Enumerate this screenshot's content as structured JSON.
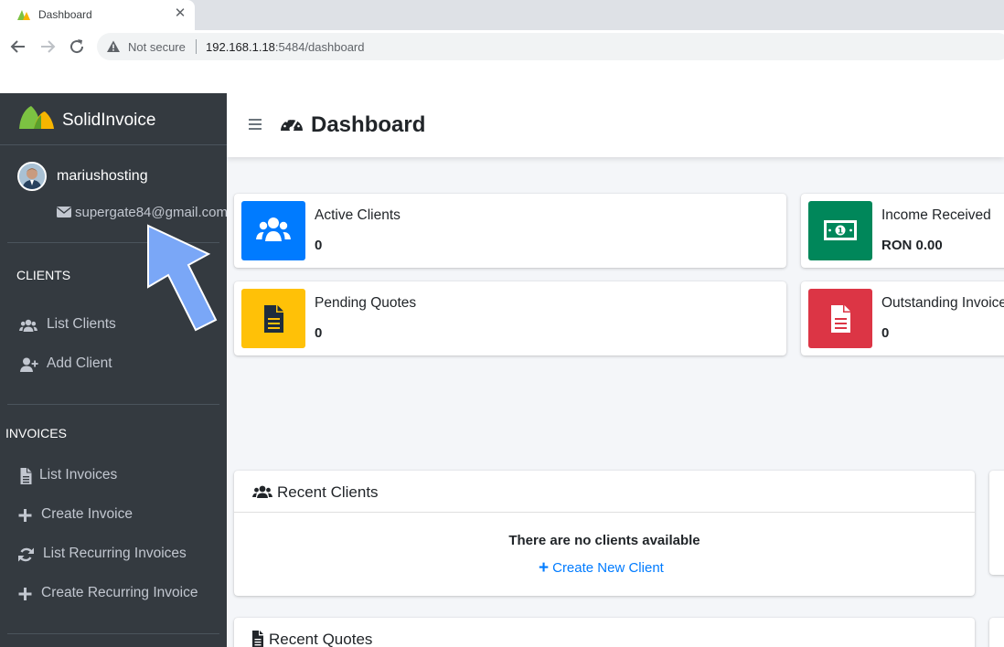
{
  "browser": {
    "tab_title": "Dashboard",
    "tab_close": "✕",
    "not_secure": "Not secure",
    "url_host": "192.168.1.18",
    "url_path": ":5484/dashboard"
  },
  "sidebar": {
    "brand": "SolidInvoice",
    "user": {
      "name": "mariushosting",
      "email": "supergate84@gmail.com"
    },
    "sections": [
      {
        "header": "CLIENTS",
        "items": [
          {
            "label": "List Clients",
            "icon": "users-icon"
          },
          {
            "label": "Add Client",
            "icon": "user-plus-icon"
          }
        ]
      },
      {
        "header": "INVOICES",
        "items": [
          {
            "label": "List Invoices",
            "icon": "file-icon"
          },
          {
            "label": "Create Invoice",
            "icon": "plus-icon"
          },
          {
            "label": "List Recurring Invoices",
            "icon": "sync-icon"
          },
          {
            "label": "Create Recurring Invoice",
            "icon": "plus-icon"
          }
        ]
      }
    ]
  },
  "main": {
    "title": "Dashboard",
    "info_boxes": [
      {
        "label": "Active Clients",
        "value": "0",
        "color": "#007bff",
        "icon": "users-icon"
      },
      {
        "label": "Income Received",
        "value": "RON 0.00",
        "color": "#00875a",
        "icon": "money-bill-icon"
      },
      {
        "label": "Pending Quotes",
        "value": "0",
        "color": "#ffc107",
        "icon": "file-alt-icon"
      },
      {
        "label": "Outstanding Invoices",
        "value": "0",
        "color": "#dc3545",
        "icon": "file-invoice-icon"
      }
    ],
    "recent_clients": {
      "title": "Recent Clients",
      "empty_text": "There are no clients available",
      "create_link": "Create New Client"
    },
    "recent_quotes": {
      "title": "Recent Quotes"
    }
  },
  "colors": {
    "sidebar_bg": "#343a40",
    "link": "#007bff",
    "annotation_arrow": "#7aa7f7"
  }
}
